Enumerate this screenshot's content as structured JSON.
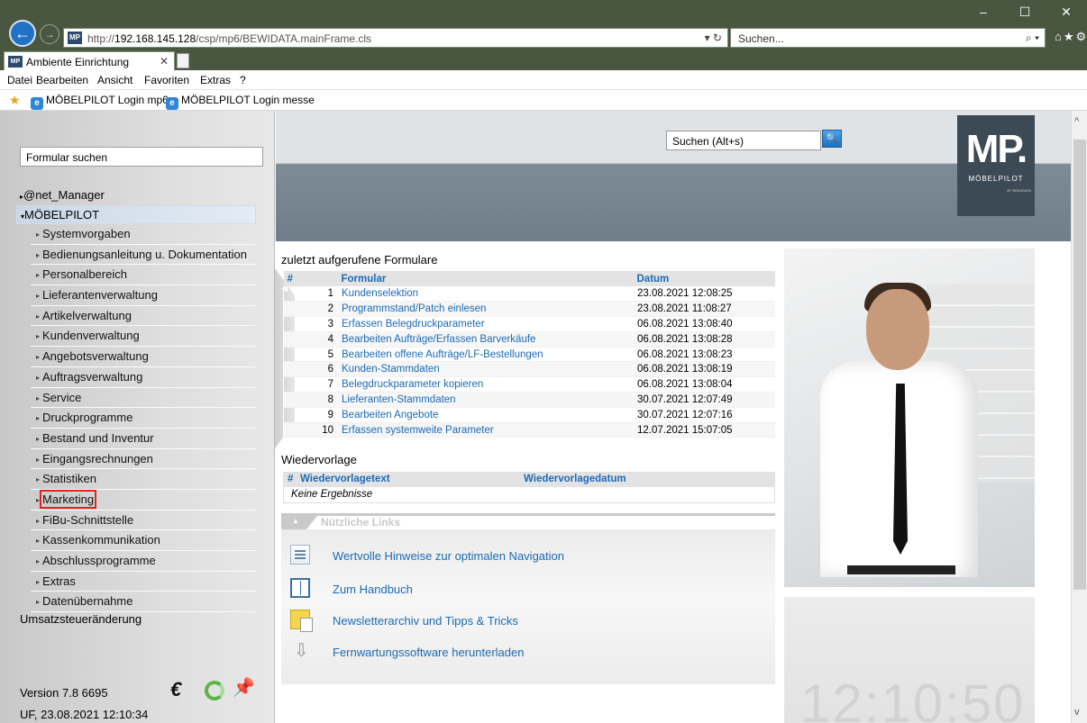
{
  "browser": {
    "url_prefix": "http://",
    "url_host": "192.168.145.128",
    "url_path": "/csp/mp6/BEWIDATA.mainFrame.cls",
    "search_placeholder": "Suchen...",
    "tab_title": "Ambiente Einrichtung",
    "menu": [
      "Datei",
      "Bearbeiten",
      "Ansicht",
      "Favoriten",
      "Extras",
      "?"
    ],
    "favorites": [
      "MÖBELPILOT Login mp6",
      "MÖBELPILOT Login messe"
    ]
  },
  "sidebar": {
    "search_placeholder": "Formular suchen",
    "top_items": [
      "@net_Manager",
      "MÖBELPILOT"
    ],
    "items": [
      "Systemvorgaben",
      "Bedienungsanleitung u. Dokumentation",
      "Personalbereich",
      "Lieferantenverwaltung",
      "Artikelverwaltung",
      "Kundenverwaltung",
      "Angebotsverwaltung",
      "Auftragsverwaltung",
      "Service",
      "Druckprogramme",
      "Bestand und Inventur",
      "Eingangsrechnungen",
      "Statistiken",
      "Marketing",
      "FiBu-Schnittstelle",
      "Kassenkommunikation",
      "Abschlussprogramme",
      "Extras",
      "Datenübernahme"
    ],
    "highlighted_item": "Marketing",
    "extra_item": "Umsatzsteueränderung",
    "version": "Version 7.8 6695",
    "timestamp": "UF, 23.08.2021 12:10:34"
  },
  "header": {
    "search_placeholder": "Suchen (Alt+s)",
    "logo_text": "MP.",
    "logo_brand": "MÖBELPILOT",
    "logo_sub": "BY BEWIDATA"
  },
  "recent": {
    "title": "zuletzt aufgerufene Formulare",
    "columns": [
      "#",
      "Formular",
      "Datum"
    ],
    "rows": [
      {
        "n": "1",
        "form": "Kundenselektion",
        "date": "23.08.2021 12:08:25"
      },
      {
        "n": "2",
        "form": "Programmstand/Patch einlesen",
        "date": "23.08.2021 11:08:27"
      },
      {
        "n": "3",
        "form": "Erfassen Belegdruckparameter",
        "date": "06.08.2021 13:08:40"
      },
      {
        "n": "4",
        "form": "Bearbeiten Aufträge/Erfassen Barverkäufe",
        "date": "06.08.2021 13:08:28"
      },
      {
        "n": "5",
        "form": "Bearbeiten offene Aufträge/LF-Bestellungen",
        "date": "06.08.2021 13:08:23"
      },
      {
        "n": "6",
        "form": "Kunden-Stammdaten",
        "date": "06.08.2021 13:08:19"
      },
      {
        "n": "7",
        "form": "Belegdruckparameter kopieren",
        "date": "06.08.2021 13:08:04"
      },
      {
        "n": "8",
        "form": "Lieferanten-Stammdaten",
        "date": "30.07.2021 12:07:49"
      },
      {
        "n": "9",
        "form": "Bearbeiten Angebote",
        "date": "30.07.2021 12:07:16"
      },
      {
        "n": "10",
        "form": "Erfassen systemweite Parameter",
        "date": "12.07.2021 15:07:05"
      }
    ]
  },
  "wiedervorlage": {
    "title": "Wiedervorlage",
    "col_num": "#",
    "col_text": "Wiedervorlagetext",
    "col_date": "Wiedervorlagedatum",
    "empty": "Keine Ergebnisse"
  },
  "links": {
    "title": "Nützliche Links",
    "items": [
      "Wertvolle Hinweise zur optimalen Navigation",
      "Zum Handbuch",
      "Newsletterarchiv und Tipps & Tricks",
      "Fernwartungssoftware herunterladen"
    ]
  },
  "clock": "12:10:50"
}
